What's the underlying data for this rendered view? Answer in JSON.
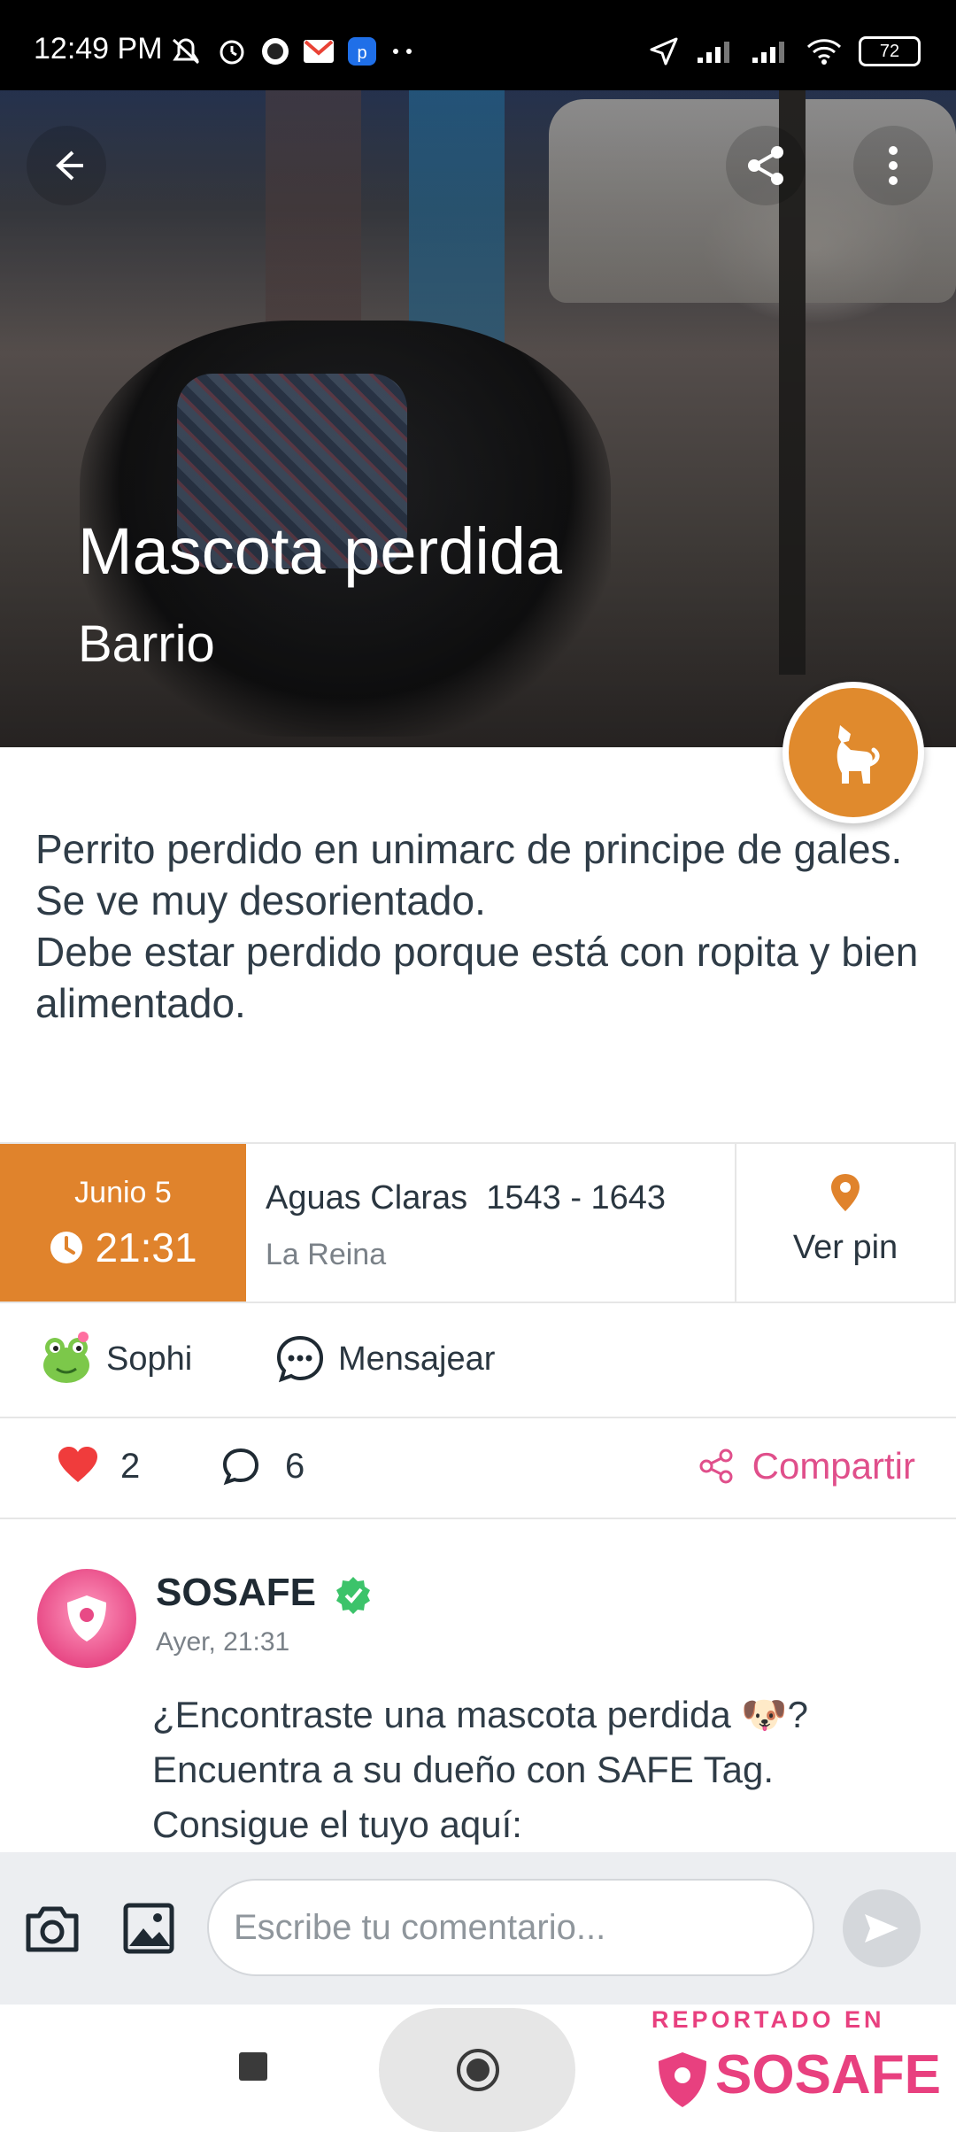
{
  "status_bar": {
    "time": "12:49 PM",
    "battery": "72"
  },
  "hero": {
    "title": "Mascota perdida",
    "subtitle": "Barrio"
  },
  "description": "Perrito perdido en unimarc de principe de gales. Se ve muy desorientado.\nDebe estar perdido porque está con ropita y bien alimentado.",
  "info": {
    "date": "Junio 5",
    "time": "21:31",
    "street": "Aguas Claras  1543 - 1643",
    "commune": "La Reina",
    "pin_label": "Ver pin"
  },
  "user": {
    "name": "Sophi",
    "message_label": "Mensajear"
  },
  "actions": {
    "likes": "2",
    "comments": "6",
    "share_label": "Compartir"
  },
  "post": {
    "author": "SOSAFE",
    "timestamp": "Ayer, 21:31",
    "body": "¿Encontraste una mascota perdida 🐶? Encuentra a su dueño con SAFE Tag. Consigue el tuyo aquí:"
  },
  "composer": {
    "placeholder": "Escribe tu comentario..."
  },
  "watermark": {
    "reported_in": "REPORTADO EN",
    "brand": "SOSAFE"
  },
  "colors": {
    "accent_orange": "#e0832c",
    "brand_pink": "#e8407f",
    "like_red": "#f03c3c"
  }
}
